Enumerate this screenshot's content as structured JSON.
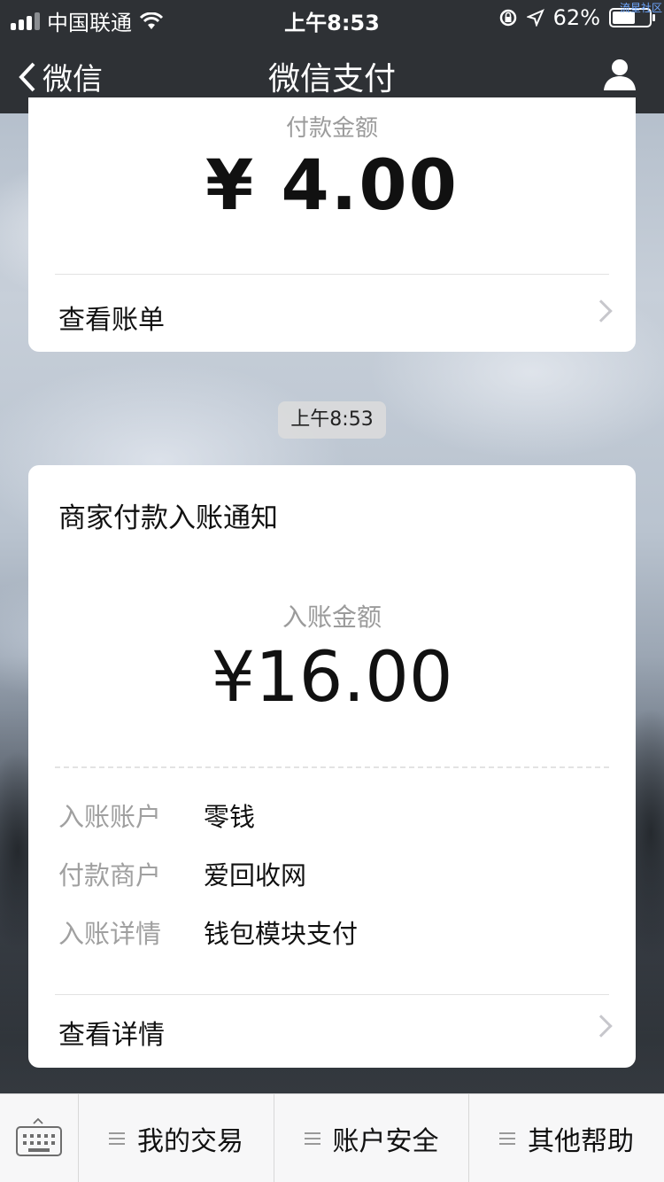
{
  "status_bar": {
    "carrier": "中国联通",
    "time": "上午8:53",
    "battery_percent": "62%",
    "battery_level": 0.62,
    "watermark": "流星社区"
  },
  "nav": {
    "back_label": "微信",
    "title": "微信支付"
  },
  "card1": {
    "amount_label": "付款金额",
    "amount": "¥ 4.00",
    "link_label": "查看账单"
  },
  "timestamp": "上午8:53",
  "card2": {
    "heading": "商家付款入账通知",
    "amount_label": "入账金额",
    "amount": "¥16.00",
    "details": [
      {
        "key": "入账账户",
        "value": "零钱"
      },
      {
        "key": "付款商户",
        "value": "爱回收网"
      },
      {
        "key": "入账详情",
        "value": "钱包模块支付"
      }
    ],
    "link_label": "查看详情"
  },
  "bottom_menu": {
    "items": [
      {
        "label": "我的交易"
      },
      {
        "label": "账户安全"
      },
      {
        "label": "其他帮助"
      }
    ]
  },
  "colors": {
    "nav_bg": "#2e3135",
    "secondary_text": "#9b9b9b",
    "chevron": "#c7c7cc"
  }
}
